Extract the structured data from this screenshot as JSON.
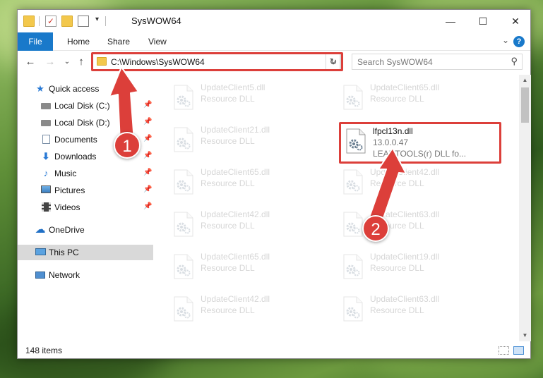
{
  "window": {
    "title": "SysWOW64",
    "controls": {
      "minimize": "—",
      "maximize": "☐",
      "close": "✕"
    }
  },
  "ribbon": {
    "tabs": [
      "File",
      "Home",
      "Share",
      "View"
    ],
    "help": "?"
  },
  "nav": {
    "address": "C:\\Windows\\SysWOW64",
    "search_placeholder": "Search SysWOW64"
  },
  "sidebar": {
    "items": [
      {
        "label": "Quick access",
        "icon": "star-icon"
      },
      {
        "label": "Local Disk (C:)",
        "icon": "drive-icon"
      },
      {
        "label": "Local Disk (D:)",
        "icon": "drive-icon"
      },
      {
        "label": "Documents",
        "icon": "documents-icon"
      },
      {
        "label": "Downloads",
        "icon": "downloads-icon"
      },
      {
        "label": "Music",
        "icon": "music-icon"
      },
      {
        "label": "Pictures",
        "icon": "pictures-icon"
      },
      {
        "label": "Videos",
        "icon": "videos-icon"
      },
      {
        "label": "OneDrive",
        "icon": "cloud-icon"
      },
      {
        "label": "This PC",
        "icon": "computer-icon"
      },
      {
        "label": "Network",
        "icon": "network-icon"
      }
    ]
  },
  "files": {
    "left_column": [
      {
        "name": "UpdateClient5.dll",
        "type": "Resource DLL"
      },
      {
        "name": "UpdateClient21.dll",
        "type": "Resource DLL"
      },
      {
        "name": "UpdateClient65.dll",
        "type": "Resource DLL"
      },
      {
        "name": "UpdateClient42.dll",
        "type": "Resource DLL"
      },
      {
        "name": "UpdateClient65.dll",
        "type": "Resource DLL"
      },
      {
        "name": "UpdateClient42.dll",
        "type": "Resource DLL"
      }
    ],
    "right_column": [
      {
        "name": "UpdateClient65.dll",
        "type": "Resource DLL"
      },
      {
        "name": "UpdateClient42.dll",
        "type": "Resource DLL"
      },
      {
        "name": "UpdateClient63.dll",
        "type": "Resource DLL"
      },
      {
        "name": "UpdateClient19.dll",
        "type": "Resource DLL"
      },
      {
        "name": "UpdateClient63.dll",
        "type": "Resource DLL"
      }
    ],
    "highlighted": {
      "name": "lfpcl13n.dll",
      "version": "13.0.0.47",
      "description": "LEADTOOLS(r) DLL fo..."
    }
  },
  "status": {
    "item_count": "148 items"
  },
  "annotations": {
    "step1": "1",
    "step2": "2",
    "color": "#dc3f3a"
  }
}
